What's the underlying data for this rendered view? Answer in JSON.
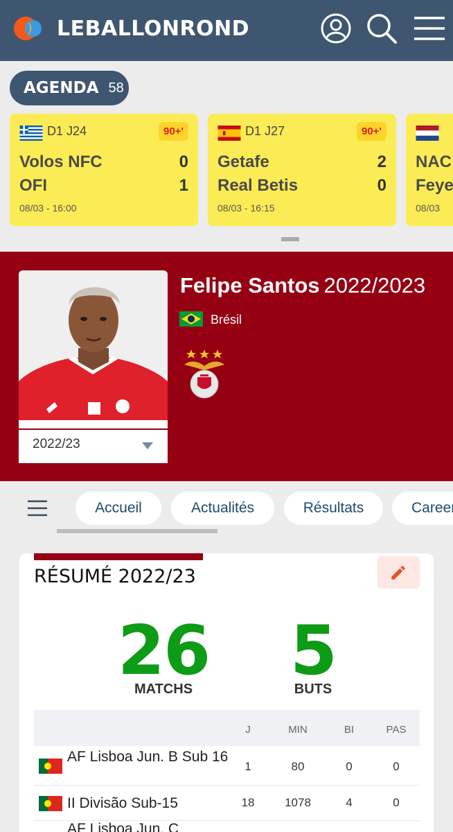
{
  "header": {
    "logo_text": "LEBALLONROND",
    "icons": [
      "user-icon",
      "search-icon",
      "menu-icon"
    ],
    "colors": {
      "bar": "#3f5670"
    }
  },
  "agenda": {
    "label": "AGENDA",
    "count": "58",
    "matches": [
      {
        "flag": "greece",
        "league": "D1 J24",
        "status": "90+'",
        "home": "Volos NFC",
        "away": "OFI",
        "home_score": "0",
        "away_score": "1",
        "datetime": "08/03 - 16:00"
      },
      {
        "flag": "spain",
        "league": "D1 J27",
        "status": "90+'",
        "home": "Getafe",
        "away": "Real Betis",
        "home_score": "2",
        "away_score": "0",
        "datetime": "08/03 - 16:15"
      },
      {
        "flag": "netherlands",
        "league": "",
        "status": "",
        "home": "NAC",
        "away": "Feye",
        "home_score": "",
        "away_score": "",
        "datetime": "08/03"
      }
    ]
  },
  "player": {
    "name": "Felipe Santos",
    "season": "2022/2023",
    "nationality": "Brésil",
    "nationality_flag": "brazil",
    "club_crest": "benfica-crest",
    "season_select": "2022/23",
    "banner_color": "#960013"
  },
  "tabs": [
    {
      "label": "Accueil"
    },
    {
      "label": "Actualités"
    },
    {
      "label": "Résultats"
    },
    {
      "label": "Career"
    }
  ],
  "summary": {
    "title": "RÉSUMÉ 2022/23",
    "matches": {
      "value": "26",
      "label": "MATCHS"
    },
    "goals": {
      "value": "5",
      "label": "BUTS"
    },
    "accent_color": "#0e9b16",
    "table": {
      "headers": [
        "J",
        "MIN",
        "BI",
        "PAS"
      ],
      "rows": [
        {
          "flag": "portugal",
          "competition": "AF Lisboa Jun. B Sub 16",
          "j": "1",
          "min": "80",
          "bi": "0",
          "pas": "0"
        },
        {
          "flag": "portugal",
          "competition": "II Divisão Sub-15",
          "j": "18",
          "min": "1078",
          "bi": "4",
          "pas": "0"
        },
        {
          "flag": "portugal",
          "competition": "AF Lisboa Jun. C",
          "j": "",
          "min": "",
          "bi": "",
          "pas": ""
        }
      ]
    }
  }
}
